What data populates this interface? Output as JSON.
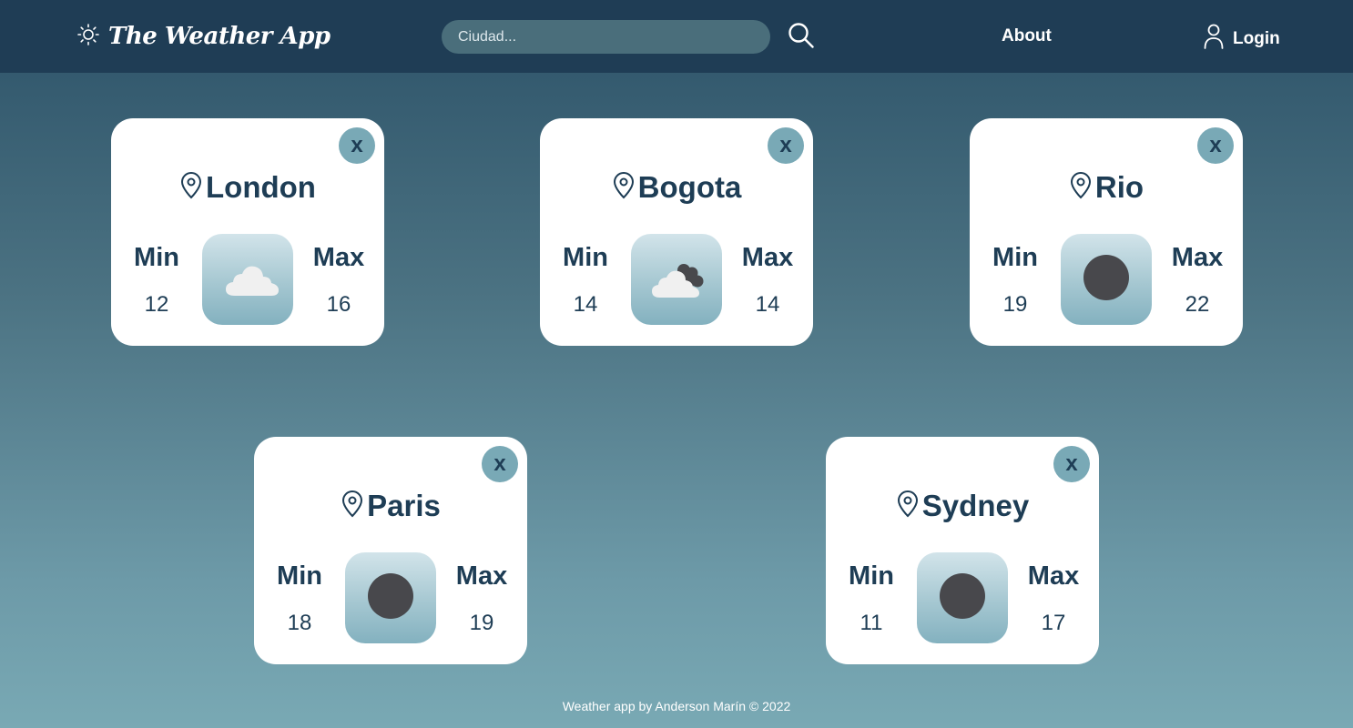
{
  "header": {
    "app_title": "The Weather App",
    "brand_icon": "sun-icon",
    "search": {
      "placeholder": "Ciudad...",
      "value": ""
    },
    "search_icon": "search-icon",
    "about_label": "About",
    "login_label": "Login",
    "login_icon": "user-icon"
  },
  "cards": [
    {
      "city": "London",
      "min_label": "Min",
      "min": "12",
      "max_label": "Max",
      "max": "16",
      "weather_icon": "cloud-icon",
      "close_label": "x"
    },
    {
      "city": "Bogota",
      "min_label": "Min",
      "min": "14",
      "max_label": "Max",
      "max": "14",
      "weather_icon": "dark-clouds-icon",
      "close_label": "x"
    },
    {
      "city": "Rio",
      "min_label": "Min",
      "min": "19",
      "max_label": "Max",
      "max": "22",
      "weather_icon": "dark-circle-icon",
      "close_label": "x"
    },
    {
      "city": "Paris",
      "min_label": "Min",
      "min": "18",
      "max_label": "Max",
      "max": "19",
      "weather_icon": "dark-circle-icon",
      "close_label": "x"
    },
    {
      "city": "Sydney",
      "min_label": "Min",
      "min": "11",
      "max_label": "Max",
      "max": "17",
      "weather_icon": "dark-circle-icon",
      "close_label": "x"
    }
  ],
  "footer": {
    "text": "Weather app by Anderson Marín © 2022"
  },
  "colors": {
    "navbar": "#1f3d55",
    "text_dark": "#1e3d55",
    "close_button": "#79a9b6",
    "search_bg": "#4a6e7b",
    "icon_dark": "#48484c"
  }
}
